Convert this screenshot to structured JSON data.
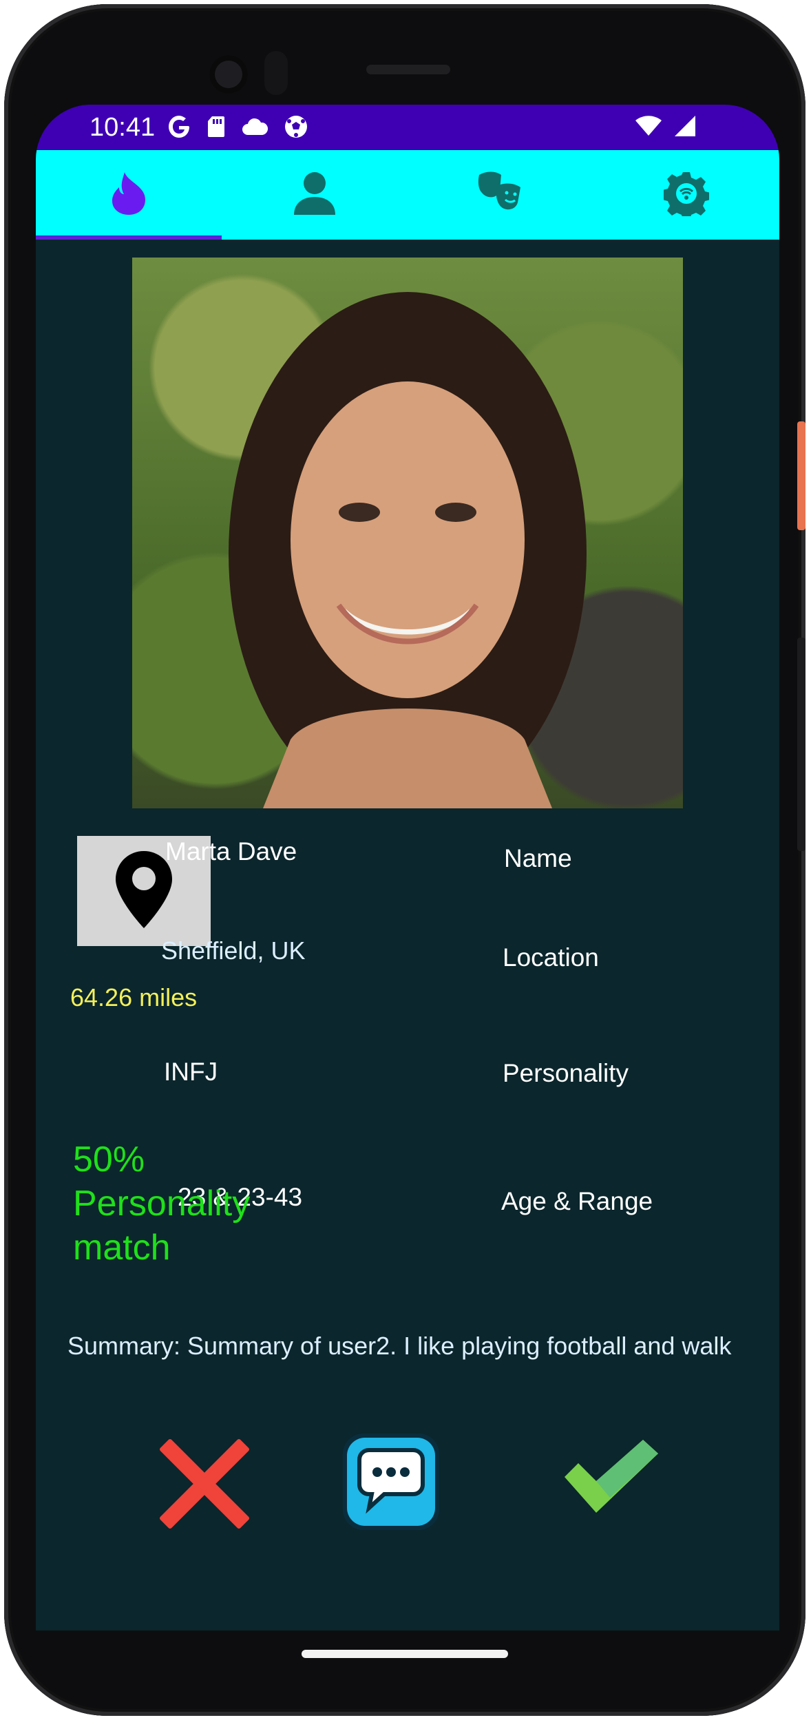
{
  "status_bar": {
    "time": "10:41",
    "left_icons": [
      "google-icon",
      "sd-card-icon",
      "cloud-icon",
      "football-icon"
    ],
    "right_icons": [
      "wifi-icon",
      "signal-icon"
    ]
  },
  "tabs": [
    {
      "name": "tab-discover",
      "icon": "flame-icon",
      "selected": true
    },
    {
      "name": "tab-profile",
      "icon": "person-icon",
      "selected": false
    },
    {
      "name": "tab-personality",
      "icon": "masks-icon",
      "selected": false
    },
    {
      "name": "tab-settings",
      "icon": "gear-icon",
      "selected": false
    }
  ],
  "profile": {
    "name": "Marta Dave",
    "location": "Sheffield, UK",
    "personality": "INFJ",
    "age_range": "23 & 23-43",
    "distance": "64.26 miles",
    "match": "50% Personality match",
    "summary": "Summary: Summary of user2. I like playing football and walk"
  },
  "labels": {
    "name": "Name",
    "location": "Location",
    "personality": "Personality",
    "age_range": "Age & Range"
  },
  "actions": {
    "reject_icon": "close-icon",
    "message_icon": "chat-icon",
    "accept_icon": "check-icon"
  },
  "colors": {
    "status_bar": "#3f00b4",
    "tab_bar": "#00ffff",
    "screen_bg": "#0b262c",
    "match_text": "#1fe01a",
    "distance_text": "#f4f05a",
    "reject": "#f0433a",
    "accept": "#7ad04a"
  }
}
